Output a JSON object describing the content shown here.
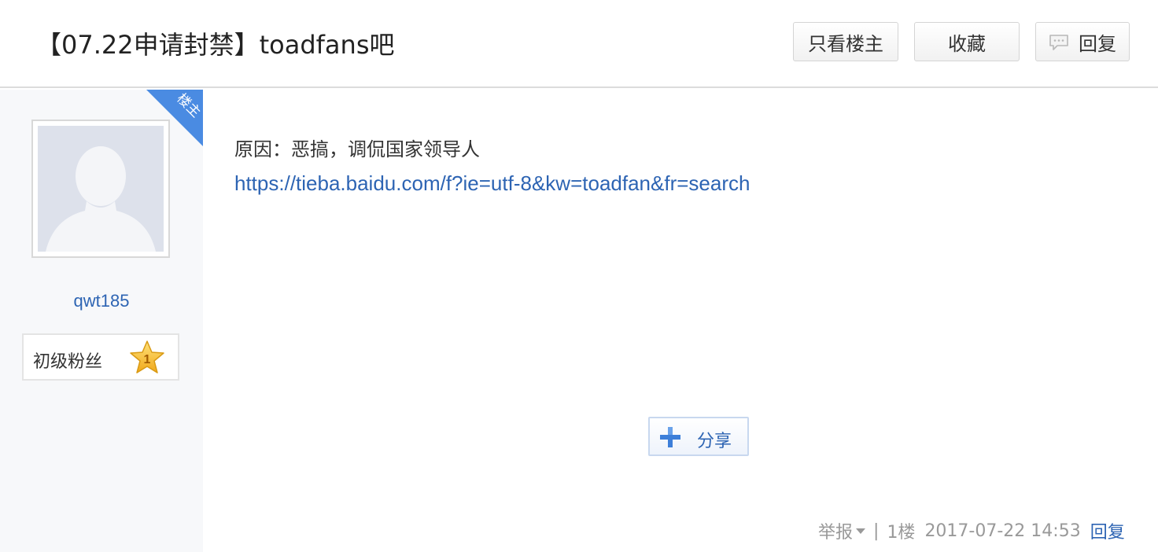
{
  "header": {
    "title": "【07.22申请封禁】toadfans吧",
    "buttons": {
      "only_lz": "只看楼主",
      "favorite": "收藏",
      "reply": "回复"
    }
  },
  "author": {
    "badge": "楼主",
    "username": "qwt185",
    "level_name": "初级粉丝",
    "level_num": "1"
  },
  "post": {
    "reason": "原因：恶搞，调侃国家领导人",
    "link": "https://tieba.baidu.com/f?ie=utf-8&kw=toadfan&fr=search",
    "share_label": "分享"
  },
  "footer": {
    "report": "举报",
    "separator": "|",
    "floor": "1楼",
    "time": "2017-07-22 14:53",
    "reply": "回复"
  },
  "colors": {
    "link_blue": "#2d64b3",
    "badge_blue": "#4a8be2",
    "star_gold": "#f5b81d"
  },
  "icons": [
    "comment-icon",
    "share-plus-icon",
    "star-icon",
    "default-avatar-icon",
    "dropdown-caret-icon"
  ]
}
